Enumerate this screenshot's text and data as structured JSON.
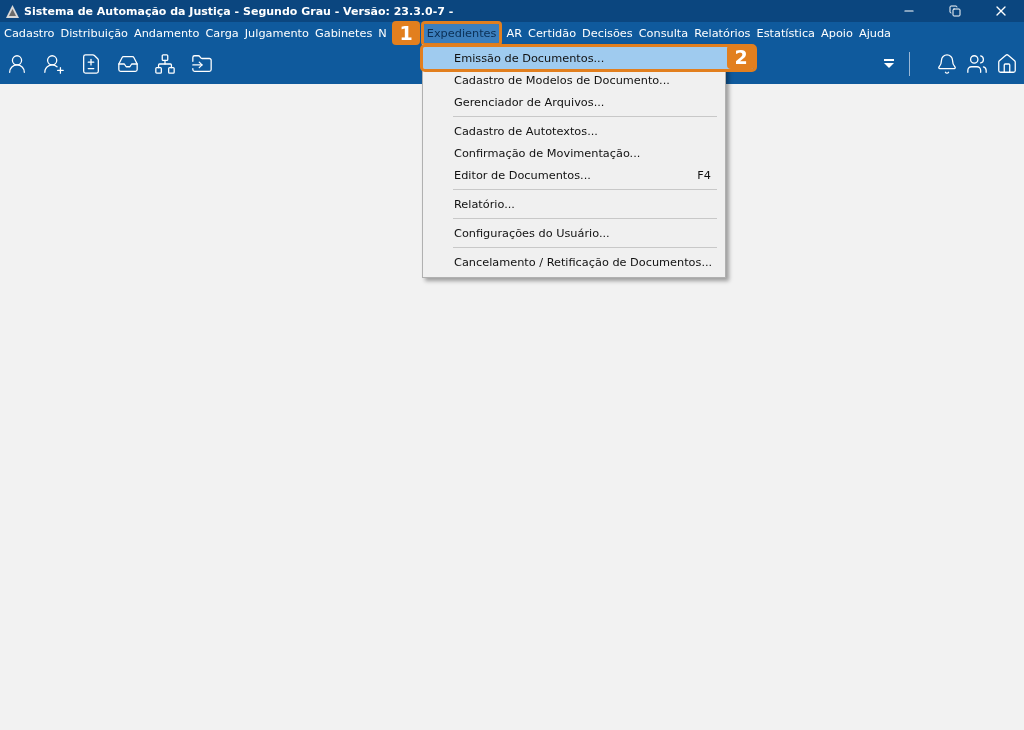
{
  "window": {
    "title": "Sistema de Automação da Justiça - Segundo Grau - Versão: 23.3.0-7 -"
  },
  "menu_bar": [
    {
      "label": "Cadastro",
      "selected": false
    },
    {
      "label": "Distribuição",
      "selected": false
    },
    {
      "label": "Andamento",
      "selected": false
    },
    {
      "label": "Carga",
      "selected": false
    },
    {
      "label": "Julgamento",
      "selected": false
    },
    {
      "label": "Gabinetes",
      "selected": false
    },
    {
      "label": "N",
      "selected": false
    },
    {
      "label": "Expedientes",
      "selected": true
    },
    {
      "label": "AR",
      "selected": false
    },
    {
      "label": "Certidão",
      "selected": false
    },
    {
      "label": "Decisões",
      "selected": false
    },
    {
      "label": "Consulta",
      "selected": false
    },
    {
      "label": "Relatórios",
      "selected": false
    },
    {
      "label": "Estatística",
      "selected": false
    },
    {
      "label": "Apoio",
      "selected": false
    },
    {
      "label": "Ajuda",
      "selected": false
    }
  ],
  "dropdown": [
    {
      "label": "Emissão de Documentos...",
      "selected": true,
      "separator_before": false
    },
    {
      "label": "Cadastro de Modelos de Documento...",
      "selected": false,
      "separator_before": false
    },
    {
      "label": "Gerenciador de Arquivos...",
      "selected": false,
      "separator_before": false
    },
    {
      "label": "Cadastro de Autotextos...",
      "selected": false,
      "separator_before": true
    },
    {
      "label": "Confirmação de Movimentação...",
      "selected": false,
      "separator_before": false
    },
    {
      "label": "Editor de Documentos...",
      "shortcut": "F4",
      "selected": false,
      "separator_before": false
    },
    {
      "label": "Relatório...",
      "selected": false,
      "separator_before": true
    },
    {
      "label": "Configurações do Usuário...",
      "selected": false,
      "separator_before": true
    },
    {
      "label": "Cancelamento / Retificação de Documentos...",
      "selected": false,
      "separator_before": true
    }
  ],
  "callouts": [
    "1",
    "2"
  ]
}
